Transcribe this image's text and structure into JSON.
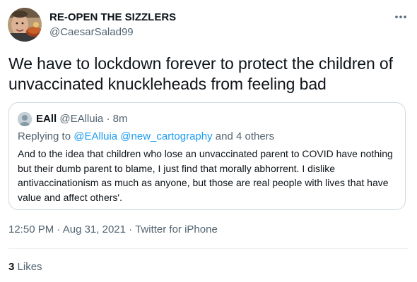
{
  "author": {
    "display_name": "RE-OPEN THE SIZZLERS",
    "handle": "@CaesarSalad99"
  },
  "tweet": {
    "text": "We have to lockdown forever to protect the children of unvaccinated knuckleheads from feeling bad",
    "time": "12:50 PM",
    "date": "Aug 31, 2021",
    "source": "Twitter for iPhone",
    "separator": "·"
  },
  "quoted_tweet": {
    "display_name": "EAll",
    "handle": "@EAlluia",
    "age": "8m",
    "separator": "·",
    "replying_prefix": "Replying to",
    "replying_to": "@EAlluia @new_cartography",
    "replying_suffix": "and 4 others",
    "text": "And to the idea that children who lose an unvaccinated parent to COVID have nothing but their dumb parent to blame, I just find that morally abhorrent. I dislike antivaccinationism as much as anyone, but those are real people with lives that have value and affect others'."
  },
  "stats": {
    "likes_count": "3",
    "likes_label": "Likes"
  },
  "icons": {
    "more": "more-horizontal-icon"
  },
  "colors": {
    "text_primary": "#0f1419",
    "text_secondary": "#536471",
    "link": "#1d9bf0",
    "border": "#cfd9de"
  }
}
